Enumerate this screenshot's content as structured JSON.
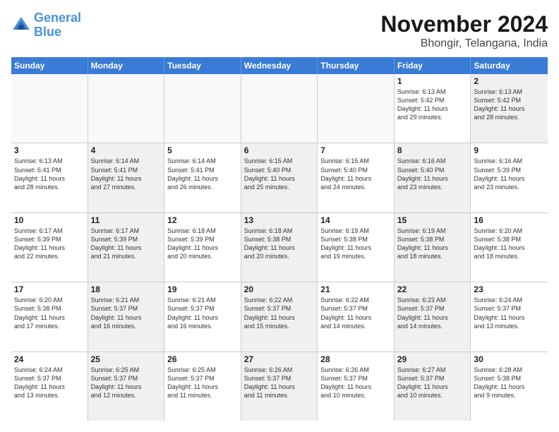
{
  "logo": {
    "text_general": "General",
    "text_blue": "Blue"
  },
  "title": "November 2024",
  "location": "Bhongir, Telangana, India",
  "header_days": [
    "Sunday",
    "Monday",
    "Tuesday",
    "Wednesday",
    "Thursday",
    "Friday",
    "Saturday"
  ],
  "weeks": [
    [
      {
        "day": "",
        "info": "",
        "empty": true
      },
      {
        "day": "",
        "info": "",
        "empty": true
      },
      {
        "day": "",
        "info": "",
        "empty": true
      },
      {
        "day": "",
        "info": "",
        "empty": true
      },
      {
        "day": "",
        "info": "",
        "empty": true
      },
      {
        "day": "1",
        "info": "Sunrise: 6:13 AM\nSunset: 5:42 PM\nDaylight: 11 hours\nand 29 minutes.",
        "empty": false
      },
      {
        "day": "2",
        "info": "Sunrise: 6:13 AM\nSunset: 5:42 PM\nDaylight: 11 hours\nand 28 minutes.",
        "empty": false,
        "shaded": true
      }
    ],
    [
      {
        "day": "3",
        "info": "Sunrise: 6:13 AM\nSunset: 5:41 PM\nDaylight: 11 hours\nand 28 minutes.",
        "empty": false
      },
      {
        "day": "4",
        "info": "Sunrise: 6:14 AM\nSunset: 5:41 PM\nDaylight: 11 hours\nand 27 minutes.",
        "empty": false,
        "shaded": true
      },
      {
        "day": "5",
        "info": "Sunrise: 6:14 AM\nSunset: 5:41 PM\nDaylight: 11 hours\nand 26 minutes.",
        "empty": false
      },
      {
        "day": "6",
        "info": "Sunrise: 6:15 AM\nSunset: 5:40 PM\nDaylight: 11 hours\nand 25 minutes.",
        "empty": false,
        "shaded": true
      },
      {
        "day": "7",
        "info": "Sunrise: 6:15 AM\nSunset: 5:40 PM\nDaylight: 11 hours\nand 24 minutes.",
        "empty": false
      },
      {
        "day": "8",
        "info": "Sunrise: 6:16 AM\nSunset: 5:40 PM\nDaylight: 11 hours\nand 23 minutes.",
        "empty": false,
        "shaded": true
      },
      {
        "day": "9",
        "info": "Sunrise: 6:16 AM\nSunset: 5:39 PM\nDaylight: 11 hours\nand 23 minutes.",
        "empty": false
      }
    ],
    [
      {
        "day": "10",
        "info": "Sunrise: 6:17 AM\nSunset: 5:39 PM\nDaylight: 11 hours\nand 22 minutes.",
        "empty": false
      },
      {
        "day": "11",
        "info": "Sunrise: 6:17 AM\nSunset: 5:39 PM\nDaylight: 11 hours\nand 21 minutes.",
        "empty": false,
        "shaded": true
      },
      {
        "day": "12",
        "info": "Sunrise: 6:18 AM\nSunset: 5:39 PM\nDaylight: 11 hours\nand 20 minutes.",
        "empty": false
      },
      {
        "day": "13",
        "info": "Sunrise: 6:18 AM\nSunset: 5:38 PM\nDaylight: 11 hours\nand 20 minutes.",
        "empty": false,
        "shaded": true
      },
      {
        "day": "14",
        "info": "Sunrise: 6:19 AM\nSunset: 5:38 PM\nDaylight: 11 hours\nand 19 minutes.",
        "empty": false
      },
      {
        "day": "15",
        "info": "Sunrise: 6:19 AM\nSunset: 5:38 PM\nDaylight: 11 hours\nand 18 minutes.",
        "empty": false,
        "shaded": true
      },
      {
        "day": "16",
        "info": "Sunrise: 6:20 AM\nSunset: 5:38 PM\nDaylight: 11 hours\nand 18 minutes.",
        "empty": false
      }
    ],
    [
      {
        "day": "17",
        "info": "Sunrise: 6:20 AM\nSunset: 5:38 PM\nDaylight: 11 hours\nand 17 minutes.",
        "empty": false
      },
      {
        "day": "18",
        "info": "Sunrise: 6:21 AM\nSunset: 5:37 PM\nDaylight: 11 hours\nand 16 minutes.",
        "empty": false,
        "shaded": true
      },
      {
        "day": "19",
        "info": "Sunrise: 6:21 AM\nSunset: 5:37 PM\nDaylight: 11 hours\nand 16 minutes.",
        "empty": false
      },
      {
        "day": "20",
        "info": "Sunrise: 6:22 AM\nSunset: 5:37 PM\nDaylight: 11 hours\nand 15 minutes.",
        "empty": false,
        "shaded": true
      },
      {
        "day": "21",
        "info": "Sunrise: 6:22 AM\nSunset: 5:37 PM\nDaylight: 11 hours\nand 14 minutes.",
        "empty": false
      },
      {
        "day": "22",
        "info": "Sunrise: 6:23 AM\nSunset: 5:37 PM\nDaylight: 11 hours\nand 14 minutes.",
        "empty": false,
        "shaded": true
      },
      {
        "day": "23",
        "info": "Sunrise: 6:24 AM\nSunset: 5:37 PM\nDaylight: 11 hours\nand 13 minutes.",
        "empty": false
      }
    ],
    [
      {
        "day": "24",
        "info": "Sunrise: 6:24 AM\nSunset: 5:37 PM\nDaylight: 11 hours\nand 13 minutes.",
        "empty": false
      },
      {
        "day": "25",
        "info": "Sunrise: 6:25 AM\nSunset: 5:37 PM\nDaylight: 11 hours\nand 12 minutes.",
        "empty": false,
        "shaded": true
      },
      {
        "day": "26",
        "info": "Sunrise: 6:25 AM\nSunset: 5:37 PM\nDaylight: 11 hours\nand 11 minutes.",
        "empty": false
      },
      {
        "day": "27",
        "info": "Sunrise: 6:26 AM\nSunset: 5:37 PM\nDaylight: 11 hours\nand 11 minutes.",
        "empty": false,
        "shaded": true
      },
      {
        "day": "28",
        "info": "Sunrise: 6:26 AM\nSunset: 5:37 PM\nDaylight: 11 hours\nand 10 minutes.",
        "empty": false
      },
      {
        "day": "29",
        "info": "Sunrise: 6:27 AM\nSunset: 5:37 PM\nDaylight: 11 hours\nand 10 minutes.",
        "empty": false,
        "shaded": true
      },
      {
        "day": "30",
        "info": "Sunrise: 6:28 AM\nSunset: 5:38 PM\nDaylight: 11 hours\nand 9 minutes.",
        "empty": false
      }
    ]
  ]
}
